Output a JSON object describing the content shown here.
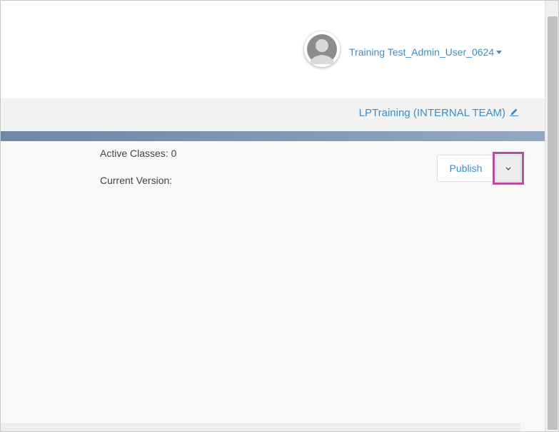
{
  "header": {
    "user_name": "Training Test_Admin_User_0624",
    "avatar_icon": "user-avatar-icon",
    "caret_icon": "caret-down-icon"
  },
  "org_bar": {
    "org_name": "LPTraining (INTERNAL TEAM)",
    "edit_icon": "pencil-icon"
  },
  "toolbar": {
    "publish_label": "Publish",
    "dropdown_icon": "chevron-down-icon"
  },
  "details": {
    "active_classes": "Active Classes: 0",
    "current_version": "Current Version:"
  },
  "colors": {
    "link": "#3a8fc9",
    "highlight": "#b84ea3",
    "accent_bar": "#7a92ae"
  }
}
